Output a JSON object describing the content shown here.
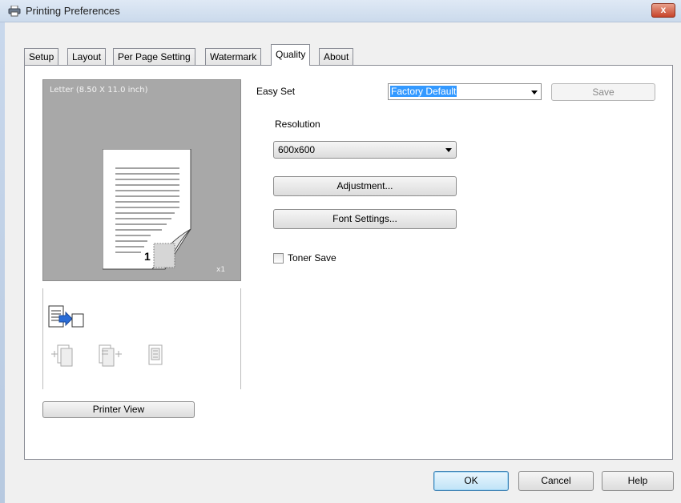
{
  "window": {
    "title": "Printing Preferences",
    "close_label": "x"
  },
  "tabs": [
    {
      "label": "Setup"
    },
    {
      "label": "Layout"
    },
    {
      "label": "Per Page Setting"
    },
    {
      "label": "Watermark"
    },
    {
      "label": "Quality",
      "active": true
    },
    {
      "label": "About"
    }
  ],
  "preview": {
    "paper_label": "Letter  (8.50 X 11.0 inch)",
    "page_number": "1",
    "copies": "x1",
    "printer_view_label": "Printer View"
  },
  "easy_set": {
    "label": "Easy Set",
    "value": "Factory Default",
    "save_label": "Save"
  },
  "resolution": {
    "label": "Resolution",
    "value": "600x600"
  },
  "buttons": {
    "adjustment": "Adjustment...",
    "font_settings": "Font Settings...",
    "ok": "OK",
    "cancel": "Cancel",
    "help": "Help"
  },
  "toner_save": {
    "label": "Toner Save",
    "checked": false
  },
  "colors": {
    "selection": "#3399ff",
    "preview_bg": "#a8a8a8",
    "title_bar": "#cbdaec",
    "close_button": "#c7442a"
  }
}
